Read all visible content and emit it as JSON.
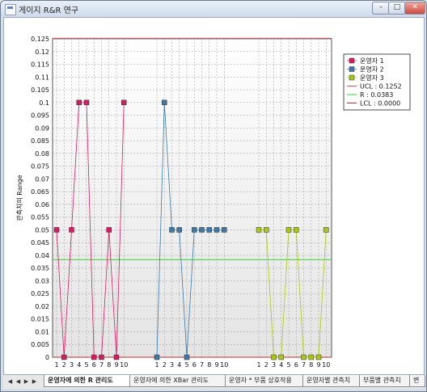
{
  "window": {
    "title": "게이지 R&R 연구"
  },
  "window_buttons": {
    "minimize": "–",
    "maximize": "□",
    "close": "✕"
  },
  "tabs": {
    "nav": [
      "◀",
      "◀",
      "▶",
      "▶"
    ],
    "items": [
      {
        "label": "운영자에 의한 R 관리도",
        "active": true
      },
      {
        "label": "운영자에 의한 XBar 관리도",
        "active": false
      },
      {
        "label": "운영자 * 부품 상호작용",
        "active": false
      },
      {
        "label": "운영자별 관측치",
        "active": false
      },
      {
        "label": "부품별 관측치",
        "active": false
      },
      {
        "label": "변",
        "active": false
      }
    ]
  },
  "chart_data": {
    "type": "line",
    "ylabel": "관측치의 Range",
    "ylim": [
      0,
      0.125
    ],
    "y_ticks": [
      "0",
      "0.005",
      "0.01",
      "0.015",
      "0.02",
      "0.025",
      "0.03",
      "0.035",
      "0.04",
      "0.045",
      "0.05",
      "0.055",
      "0.06",
      "0.065",
      "0.07",
      "0.075",
      "0.08",
      "0.085",
      "0.09",
      "0.095",
      "0.1",
      "0.105",
      "0.11",
      "0.115",
      "0.12",
      "0.125"
    ],
    "x_tick_labels": [
      "1",
      "2",
      "3",
      "4",
      "5",
      "6",
      "7",
      "8",
      "9",
      "10"
    ],
    "series": [
      {
        "name": "운영자 1",
        "color": "#d81b60",
        "values": [
          0.05,
          0,
          0.05,
          0.1,
          0.1,
          0,
          0,
          0.05,
          0,
          0.1
        ]
      },
      {
        "name": "운영자 2",
        "color": "#3c78a8",
        "values": [
          0,
          0.1,
          0.05,
          0.05,
          0,
          0.05,
          0.05,
          0.05,
          0.05,
          0.05
        ]
      },
      {
        "name": "운영자 3",
        "color": "#a8c814",
        "values": [
          0.05,
          0.05,
          0,
          0,
          0.05,
          0.05,
          0,
          0,
          0,
          0.05
        ]
      }
    ],
    "limits": [
      {
        "name": "UCL : 0.1252",
        "value": 0.1252,
        "color": "#e05050"
      },
      {
        "name": "R : 0.0383",
        "value": 0.0383,
        "color": "#30d030"
      },
      {
        "name": "LCL : 0.0000",
        "value": 0,
        "color": "#c03030"
      }
    ],
    "grid": true,
    "legend_position": "top-right"
  }
}
